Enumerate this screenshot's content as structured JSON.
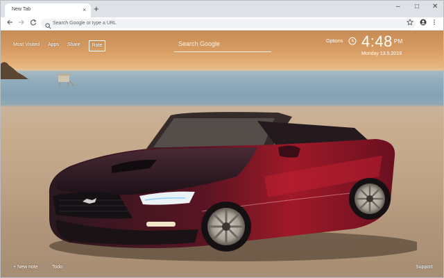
{
  "browser": {
    "tab_title": "New Tab",
    "tab_close": "×",
    "new_tab": "+",
    "window_controls": {
      "minimize": "–",
      "maximize": "□",
      "close": "✕"
    },
    "omnibox_placeholder": "Search Google or type a URL",
    "icons": [
      "back-icon",
      "forward-icon",
      "reload-icon",
      "search-icon",
      "star-icon",
      "profile-icon",
      "menu-icon"
    ]
  },
  "newtab": {
    "nav": {
      "most_visited": "Most Visited",
      "apps": "Apps",
      "share": "Share",
      "rate": "Rate"
    },
    "search_placeholder": "Search Google",
    "options": "Options",
    "clock": {
      "time": "4:48",
      "ampm": "PM",
      "date": "Monday  13.5.2019"
    },
    "bottom": {
      "new_note": "+ New note",
      "todo": "Todo",
      "support": "Support"
    }
  },
  "colors": {
    "accent_text": "#ffffff",
    "car_red": "#8b1421",
    "sky_orange": "#d79c63"
  }
}
